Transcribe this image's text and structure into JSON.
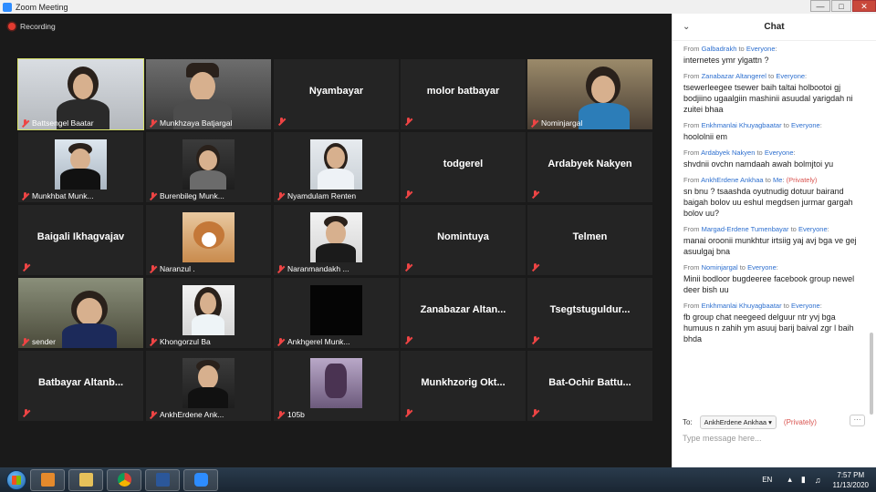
{
  "window": {
    "title": "Zoom Meeting"
  },
  "recording": {
    "label": "Recording"
  },
  "tiles": [
    {
      "name": "Battsengel Baatar",
      "type": "video"
    },
    {
      "name": "Munkhzaya Batjargal",
      "type": "video"
    },
    {
      "name": "Nyambayar",
      "type": "name"
    },
    {
      "name": "molor batbayar",
      "type": "name"
    },
    {
      "name": "Nominjargal",
      "type": "video"
    },
    {
      "name": "Munkhbat Munk...",
      "type": "video"
    },
    {
      "name": "Burenbileg Munk...",
      "type": "video"
    },
    {
      "name": "Nyamdulam Renten",
      "type": "video"
    },
    {
      "name": "todgerel",
      "type": "name"
    },
    {
      "name": "Ardabyek Nakyen",
      "type": "name"
    },
    {
      "name": "Baigali Ikhagvajav",
      "type": "name"
    },
    {
      "name": "Naranzul .",
      "type": "video"
    },
    {
      "name": "Naranmandakh ...",
      "type": "video"
    },
    {
      "name": "Nomintuya",
      "type": "name"
    },
    {
      "name": "Telmen",
      "type": "name"
    },
    {
      "name": "sender",
      "type": "video"
    },
    {
      "name": "Khongorzul Ba",
      "type": "video"
    },
    {
      "name": "Ankhgerel Munk...",
      "type": "video"
    },
    {
      "name": "Zanabazar Altan...",
      "type": "name"
    },
    {
      "name": "Tsegtstuguldur...",
      "type": "name"
    },
    {
      "name": "Batbayar Altanb...",
      "type": "name"
    },
    {
      "name": "AnkhErdene Ank...",
      "type": "video"
    },
    {
      "name": "105b",
      "type": "video"
    },
    {
      "name": "Munkhzorig Okt...",
      "type": "name"
    },
    {
      "name": "Bat-Ochir Battu...",
      "type": "name"
    }
  ],
  "chat": {
    "title": "Chat",
    "messages": [
      {
        "from": "Galbadrakh",
        "to": "Everyone",
        "private": false,
        "text": "internetes ymr ylgattn ?"
      },
      {
        "from": "Zanabazar Altangerel",
        "to": "Everyone",
        "private": false,
        "text": "tsewerleegee tsewer baih taltai holbootoi gj bodjiino ugaalgiin mashinii asuudal yarigdah ni zuitei bhaa"
      },
      {
        "from": "Enkhmanlai Khuyagbaatar",
        "to": "Everyone",
        "private": false,
        "text": "hoololnii em"
      },
      {
        "from": "Ardabyek Nakyen",
        "to": "Everyone",
        "private": false,
        "text": "shvdnii ovchn namdaah awah bolmjtoi yu"
      },
      {
        "from": "AnkhErdene Ankhaa",
        "to": "Me",
        "private": true,
        "text": "sn bnu ? tsaashda oyutnudig dotuur bairand baigah bolov uu eshul megdsen jurmar gargah bolov uu?"
      },
      {
        "from": "Margad-Erdene Tumenbayar",
        "to": "Everyone",
        "private": false,
        "text": "manai oroonii munkhtur irtsiig yaj avj bga ve gej asuulgaj bna"
      },
      {
        "from": "Nominjargal",
        "to": "Everyone",
        "private": false,
        "text": "Minii bodloor bugdeeree facebook group newel deer bish uu"
      },
      {
        "from": "Enkhmanlai Khuyagbaatar",
        "to": "Everyone",
        "private": false,
        "text": "fb group chat neegeed delguur ntr yvj bga humuus n zahih ym asuuj barij baival zgr l baih bhda"
      }
    ],
    "labels": {
      "from": "From",
      "to": "to",
      "privately": "(Privately)"
    },
    "to_label": "To:",
    "recipient": "AnkhErdene Ankhaa",
    "recipient_privately": "(Privately)",
    "more": "···",
    "input_placeholder": "Type message here..."
  },
  "taskbar": {
    "apps": [
      "windows-media-player",
      "file-explorer",
      "chrome",
      "word",
      "zoom"
    ],
    "language": "EN",
    "time": "7:57 PM",
    "date": "11/13/2020"
  }
}
